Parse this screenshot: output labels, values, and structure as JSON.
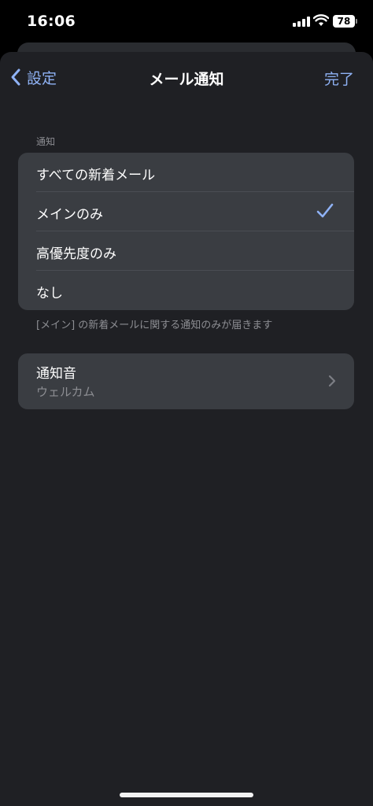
{
  "status_bar": {
    "time": "16:06",
    "battery": "78"
  },
  "nav": {
    "back_label": "設定",
    "title": "メール通知",
    "done_label": "完了"
  },
  "notifications": {
    "header": "通知",
    "options": [
      {
        "label": "すべての新着メール",
        "selected": false
      },
      {
        "label": "メインのみ",
        "selected": true
      },
      {
        "label": "高優先度のみ",
        "selected": false
      },
      {
        "label": "なし",
        "selected": false
      }
    ],
    "footer": "[メイン] の新着メールに関する通知のみが届きます"
  },
  "sound": {
    "title": "通知音",
    "value": "ウェルカム"
  },
  "colors": {
    "accent": "#8fb2f5",
    "sheet": "#1f2024",
    "cell": "#3a3d42"
  }
}
